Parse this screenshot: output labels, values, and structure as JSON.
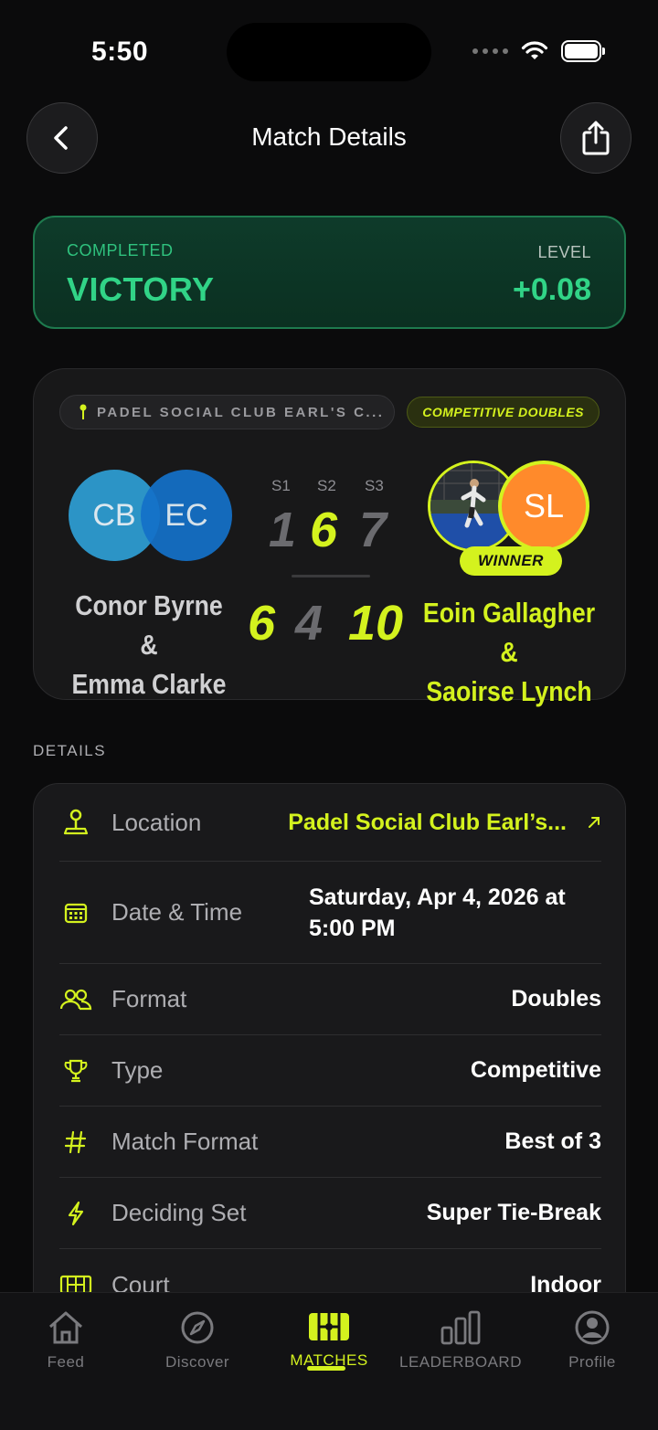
{
  "status_bar": {
    "time": "5:50"
  },
  "header": {
    "title": "Match Details"
  },
  "result": {
    "status": "COMPLETED",
    "outcome": "VICTORY",
    "level_label": "LEVEL",
    "level_change": "+0.08",
    "accent_color": "#31d487"
  },
  "match": {
    "venue": "PADEL SOCIAL CLUB EARL'S C...",
    "match_type": "COMPETITIVE DOUBLES",
    "set_headers": [
      "S1",
      "S2",
      "S3"
    ],
    "team1": {
      "name_line1": "Conor Byrne &",
      "name_line2": "Emma Clarke",
      "initials": [
        "CB",
        "EC"
      ],
      "scores": [
        "1",
        "6",
        "7"
      ]
    },
    "team2": {
      "name_line1": "Eoin Gallagher &",
      "name_line2": "Saoirse Lynch",
      "initials": [
        "SL"
      ],
      "scores": [
        "6",
        "4",
        "10"
      ],
      "badge": "WINNER"
    },
    "winner_color": "#d4f21e"
  },
  "details": {
    "section_label": "DETAILS",
    "rows": [
      {
        "label": "Location",
        "value": "Padel Social Club Earl’s...",
        "icon": "map-pin-icon"
      },
      {
        "label": "Date & Time",
        "value_line1": "Saturday, Apr 4, 2026 at",
        "value_line2": "5:00 PM",
        "icon": "calendar-icon"
      },
      {
        "label": "Format",
        "value": "Doubles",
        "icon": "users-icon"
      },
      {
        "label": "Type",
        "value": "Competitive",
        "icon": "trophy-icon"
      },
      {
        "label": "Match Format",
        "value": "Best of 3",
        "icon": "hash-icon"
      },
      {
        "label": "Deciding Set",
        "value": "Super Tie-Break",
        "icon": "lightning-icon"
      },
      {
        "label": "Court",
        "value": "Indoor",
        "icon": "court-icon"
      }
    ]
  },
  "tabbar": {
    "tabs": [
      {
        "label": "Feed",
        "icon": "home-icon"
      },
      {
        "label": "Discover",
        "icon": "compass-icon"
      },
      {
        "label": "MATCHES",
        "icon": "court-icon",
        "active": true
      },
      {
        "label": "LEADERBOARD",
        "icon": "bar-chart-icon"
      },
      {
        "label": "Profile",
        "icon": "profile-icon"
      }
    ]
  }
}
